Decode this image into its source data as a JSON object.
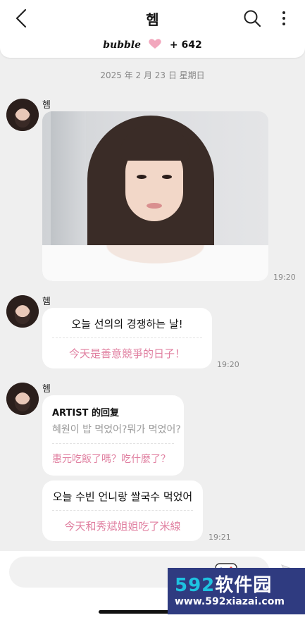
{
  "header": {
    "title": "헴",
    "bubble_word": "bubble",
    "bubble_count": "+ 642"
  },
  "date_divider": "2025 年 2 月 23 日  星期日",
  "messages": [
    {
      "sender": "헴",
      "time": "19:20"
    },
    {
      "sender": "헴",
      "ko": "오늘 선의의 경쟁하는 날!",
      "zh": "今天是善意競爭的日子！",
      "time": "19:20"
    },
    {
      "sender": "헴",
      "reply": {
        "label": "ARTIST 的回复",
        "ko": "혜원이 밥 먹었어?뭐가 먹었어?",
        "zh": "惠元吃飯了嗎？吃什麼了？"
      },
      "ko": "오늘 수빈 언니랑 쌀국수 먹었어",
      "zh": "今天和秀斌姐姐吃了米線",
      "time": "19:21"
    }
  ],
  "watermark": {
    "logo_num": "592",
    "logo_text": "软件园",
    "url": "www.592xiazai.com"
  },
  "colors": {
    "accent_pink": "#e07fa0",
    "background": "#efefef"
  },
  "icons": [
    "back-icon",
    "search-icon",
    "more-icon",
    "heart-icon",
    "sticker-icon",
    "send-icon"
  ]
}
